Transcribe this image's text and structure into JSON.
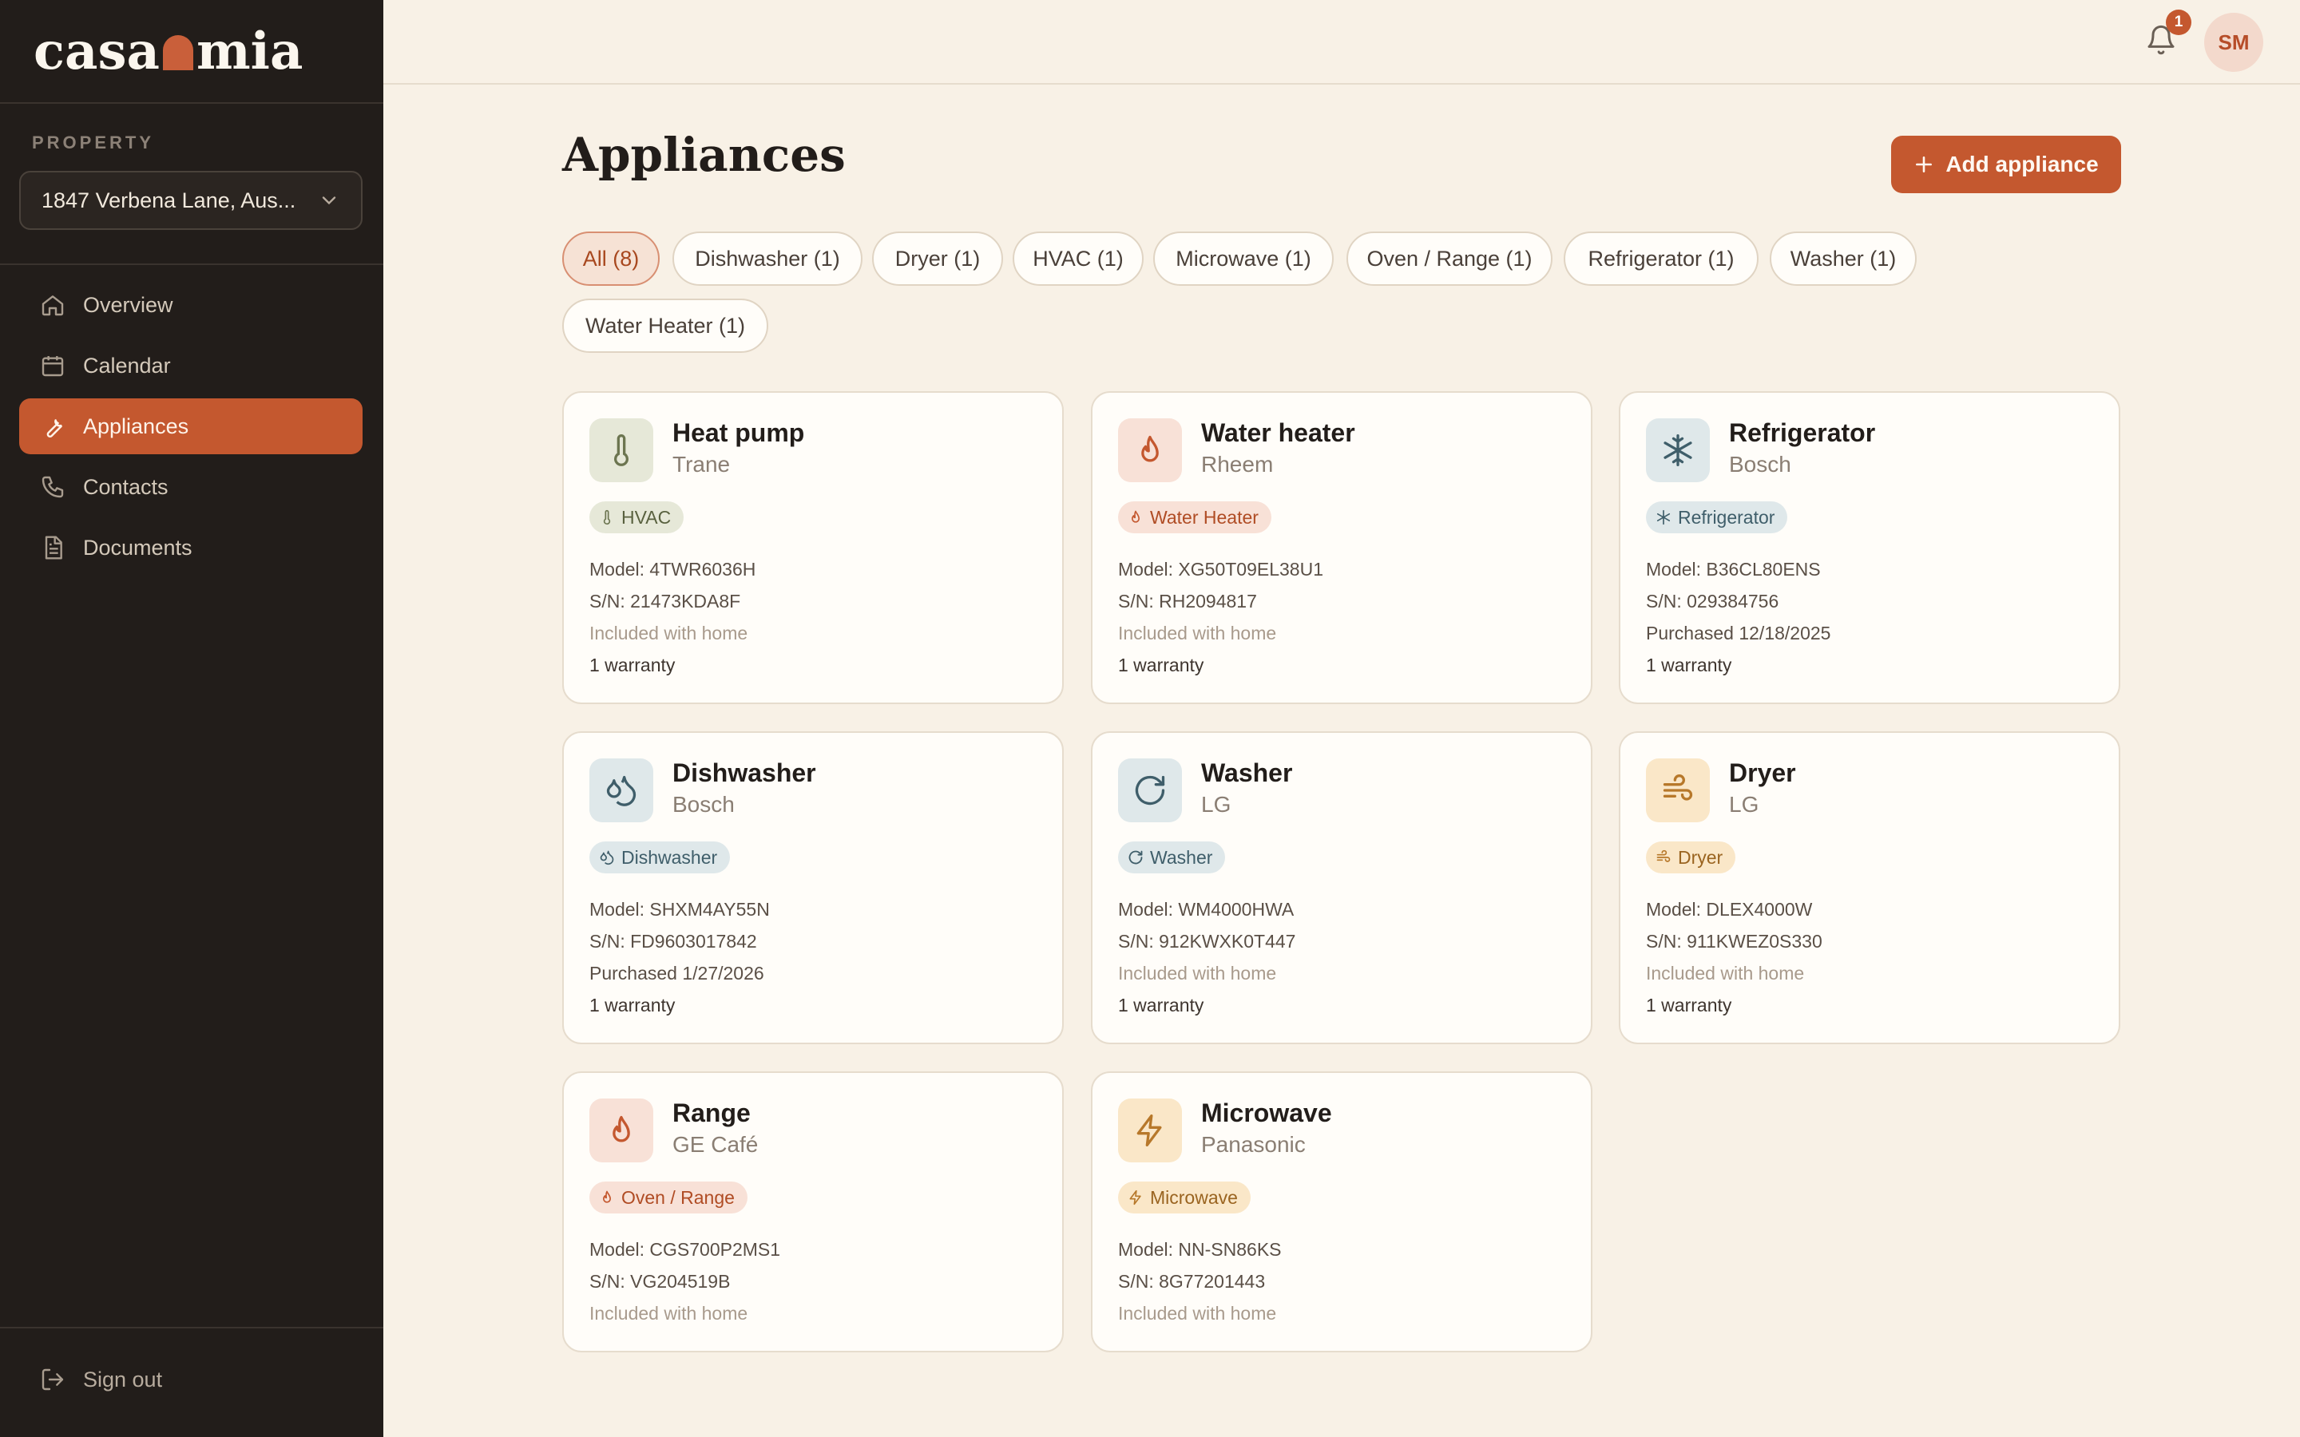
{
  "app": {
    "logo_left": "casa",
    "logo_right": "mia"
  },
  "sidebar": {
    "property_label": "PROPERTY",
    "property_value": "1847 Verbena Lane, Aus...",
    "items": [
      {
        "label": "Overview",
        "icon": "home-icon"
      },
      {
        "label": "Calendar",
        "icon": "calendar-icon"
      },
      {
        "label": "Appliances",
        "icon": "wrench-icon",
        "active": true
      },
      {
        "label": "Contacts",
        "icon": "phone-icon"
      },
      {
        "label": "Documents",
        "icon": "document-icon"
      }
    ],
    "signout_label": "Sign out"
  },
  "header": {
    "notifications_count": "1",
    "avatar_initials": "SM"
  },
  "main": {
    "title": "Appliances",
    "add_button_label": "Add appliance",
    "filters": [
      "All (8)",
      "Dishwasher (1)",
      "Dryer (1)",
      "HVAC (1)",
      "Microwave (1)",
      "Oven / Range (1)",
      "Refrigerator (1)",
      "Washer (1)",
      "Water Heater (1)"
    ],
    "cards": [
      {
        "name": "Heat pump",
        "brand": "Trane",
        "tag": "HVAC",
        "model": "Model: 4TWR6036H",
        "sn": "S/N: 21473KDA8F",
        "status": "Included with home",
        "warranty": "1 warranty"
      },
      {
        "name": "Water heater",
        "brand": "Rheem",
        "tag": "Water Heater",
        "model": "Model: XG50T09EL38U1",
        "sn": "S/N: RH2094817",
        "status": "Included with home",
        "warranty": "1 warranty"
      },
      {
        "name": "Refrigerator",
        "brand": "Bosch",
        "tag": "Refrigerator",
        "model": "Model: B36CL80ENS",
        "sn": "S/N: 029384756",
        "status": "Purchased 12/18/2025",
        "warranty": "1 warranty"
      },
      {
        "name": "Dishwasher",
        "brand": "Bosch",
        "tag": "Dishwasher",
        "model": "Model: SHXM4AY55N",
        "sn": "S/N: FD9603017842",
        "status": "Purchased 1/27/2026",
        "warranty": "1 warranty"
      },
      {
        "name": "Washer",
        "brand": "LG",
        "tag": "Washer",
        "model": "Model: WM4000HWA",
        "sn": "S/N: 912KWXK0T447",
        "status": "Included with home",
        "warranty": "1 warranty"
      },
      {
        "name": "Dryer",
        "brand": "LG",
        "tag": "Dryer",
        "model": "Model: DLEX4000W",
        "sn": "S/N: 911KWEZ0S330",
        "status": "Included with home",
        "warranty": "1 warranty"
      },
      {
        "name": "Range",
        "brand": "GE Café",
        "tag": "Oven / Range",
        "model": "Model: CGS700P2MS1",
        "sn": "S/N: VG204519B",
        "status": "Included with home"
      },
      {
        "name": "Microwave",
        "brand": "Panasonic",
        "tag": "Microwave",
        "model": "Model: NN-SN86KS",
        "sn": "S/N: 8G77201443",
        "status": "Included with home"
      }
    ]
  },
  "colors": {
    "accent": "#c4582f",
    "sidebar_bg": "#221d1a",
    "page_bg": "#f8f1e6"
  }
}
